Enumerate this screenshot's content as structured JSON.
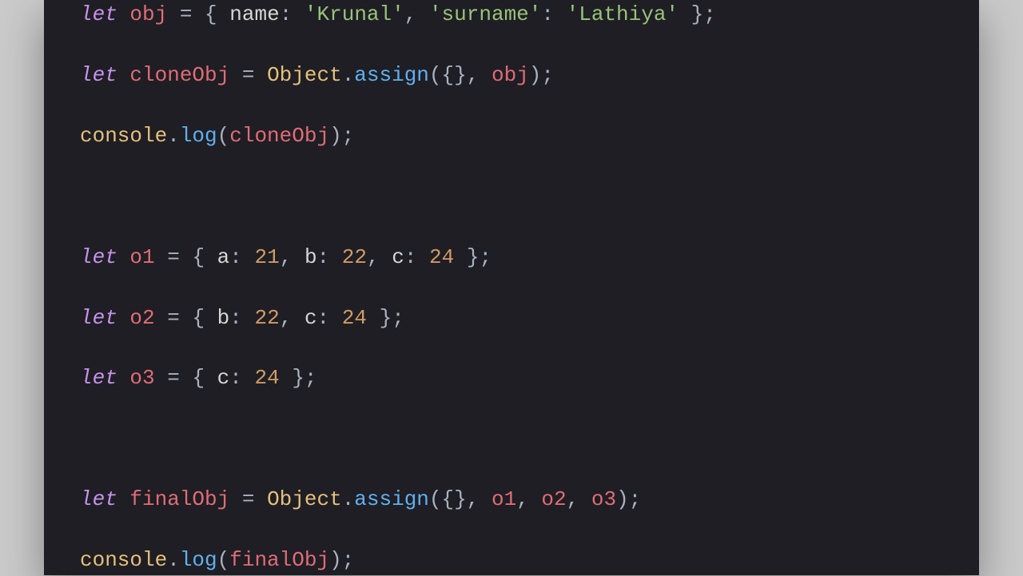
{
  "code": {
    "l1": {
      "let": "let",
      "v": "obj",
      "eq": " = ",
      "ob": "{ ",
      "k1": "name",
      "c1": ": ",
      "s1": "'Krunal'",
      "cm1": ", ",
      "k2": "'surname'",
      "c2": ": ",
      "s2": "'Lathiya'",
      "cb": " };"
    },
    "l2": {
      "let": "let",
      "v": "cloneObj",
      "eq": " = ",
      "obj": "Object",
      "dot": ".",
      "fn": "assign",
      "op": "(",
      "arg1": "{}",
      "cm": ", ",
      "arg2": "obj",
      "cp": ");"
    },
    "l3": {
      "cons": "console",
      "dot": ".",
      "fn": "log",
      "op": "(",
      "arg": "cloneObj",
      "cp": ");"
    },
    "l4": {
      "let": "let",
      "v": "o1",
      "eq": " = ",
      "ob": "{ ",
      "k1": "a",
      "c1": ": ",
      "n1": "21",
      "cm1": ", ",
      "k2": "b",
      "c2": ": ",
      "n2": "22",
      "cm2": ", ",
      "k3": "c",
      "c3": ": ",
      "n3": "24",
      "cb": " };"
    },
    "l5": {
      "let": "let",
      "v": "o2",
      "eq": " = ",
      "ob": "{ ",
      "k1": "b",
      "c1": ": ",
      "n1": "22",
      "cm1": ", ",
      "k2": "c",
      "c2": ": ",
      "n2": "24",
      "cb": " };"
    },
    "l6": {
      "let": "let",
      "v": "o3",
      "eq": " = ",
      "ob": "{ ",
      "k1": "c",
      "c1": ": ",
      "n1": "24",
      "cb": " };"
    },
    "l7": {
      "let": "let",
      "v": "finalObj",
      "eq": " = ",
      "obj": "Object",
      "dot": ".",
      "fn": "assign",
      "op": "(",
      "a1": "{}",
      "cm1": ", ",
      "a2": "o1",
      "cm2": ", ",
      "a3": "o2",
      "cm3": ", ",
      "a4": "o3",
      "cp": ");"
    },
    "l8": {
      "cons": "console",
      "dot": ".",
      "fn": "log",
      "op": "(",
      "arg": "finalObj",
      "cp": ");"
    }
  }
}
